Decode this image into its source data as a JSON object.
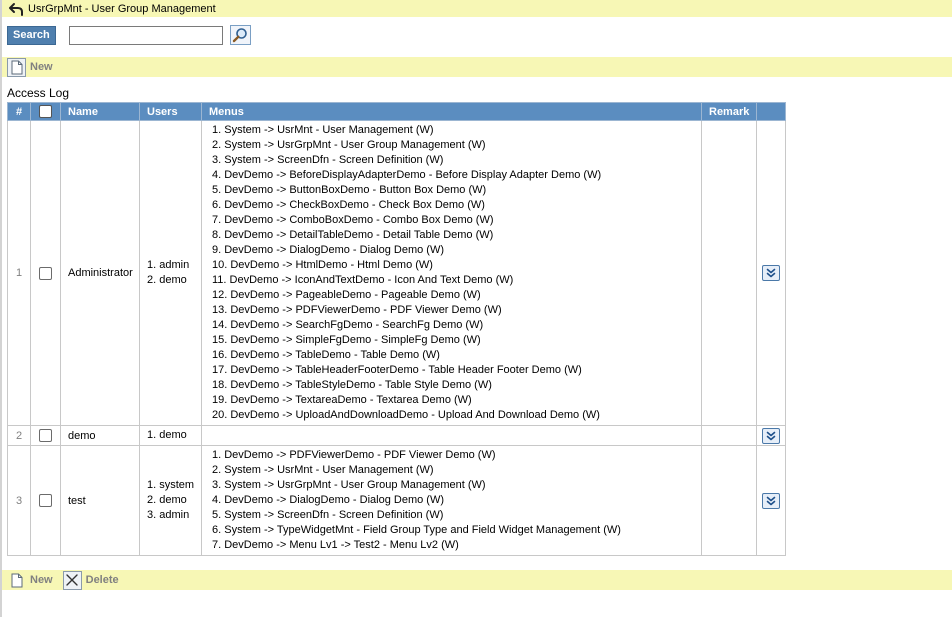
{
  "header": {
    "title": "UsrGrpMnt - User Group Management",
    "back_icon": "back-arrow-icon"
  },
  "search": {
    "button_label": "Search",
    "value": "",
    "go_icon": "magnifier-icon"
  },
  "toolbar_top": {
    "new_label": "New",
    "new_icon": "new-document-icon"
  },
  "section": {
    "title": "Access Log"
  },
  "table": {
    "headers": {
      "num": "#",
      "name": "Name",
      "users": "Users",
      "menus": "Menus",
      "remark": "Remark"
    },
    "rows": [
      {
        "num": "1",
        "name": "Administrator",
        "users": [
          "1. admin",
          "2. demo"
        ],
        "menus": [
          "1. System -> UsrMnt - User Management (W)",
          "2. System -> UsrGrpMnt - User Group Management (W)",
          "3. System -> ScreenDfn - Screen Definition (W)",
          "4. DevDemo -> BeforeDisplayAdapterDemo - Before Display Adapter Demo (W)",
          "5. DevDemo -> ButtonBoxDemo - Button Box Demo (W)",
          "6. DevDemo -> CheckBoxDemo - Check Box Demo (W)",
          "7. DevDemo -> ComboBoxDemo - Combo Box Demo (W)",
          "8. DevDemo -> DetailTableDemo - Detail Table Demo (W)",
          "9. DevDemo -> DialogDemo - Dialog Demo (W)",
          "10. DevDemo -> HtmlDemo - Html Demo (W)",
          "11. DevDemo -> IconAndTextDemo - Icon And Text Demo (W)",
          "12. DevDemo -> PageableDemo - Pageable Demo (W)",
          "13. DevDemo -> PDFViewerDemo - PDF Viewer Demo (W)",
          "14. DevDemo -> SearchFgDemo - SearchFg Demo (W)",
          "15. DevDemo -> SimpleFgDemo - SimpleFg Demo (W)",
          "16. DevDemo -> TableDemo - Table Demo (W)",
          "17. DevDemo -> TableHeaderFooterDemo - Table Header Footer Demo (W)",
          "18. DevDemo -> TableStyleDemo - Table Style Demo (W)",
          "19. DevDemo -> TextareaDemo - Textarea Demo (W)",
          "20. DevDemo -> UploadAndDownloadDemo - Upload And Download Demo (W)"
        ],
        "remark": ""
      },
      {
        "num": "2",
        "name": "demo",
        "users": [
          "1. demo"
        ],
        "menus": [],
        "remark": ""
      },
      {
        "num": "3",
        "name": "test",
        "users": [
          "1. system",
          "2. demo",
          "3. admin"
        ],
        "menus": [
          "1. DevDemo -> PDFViewerDemo - PDF Viewer Demo (W)",
          "2. System -> UsrMnt - User Management (W)",
          "3. System -> UsrGrpMnt - User Group Management (W)",
          "4. DevDemo -> DialogDemo - Dialog Demo (W)",
          "5. System -> ScreenDfn - Screen Definition (W)",
          "6. System -> TypeWidgetMnt - Field Group Type and Field Widget Management (W)",
          "7. DevDemo -> Menu Lv1 -> Test2 - Menu Lv2 (W)"
        ],
        "remark": ""
      }
    ]
  },
  "toolbar_bottom": {
    "new_label": "New",
    "new_icon": "new-document-icon",
    "delete_label": "Delete",
    "delete_icon": "delete-x-icon"
  },
  "colors": {
    "bar_yellow": "#f7f7b5",
    "header_blue": "#5b8dc0",
    "button_blue": "#4f7fae",
    "muted_label": "#808080"
  }
}
